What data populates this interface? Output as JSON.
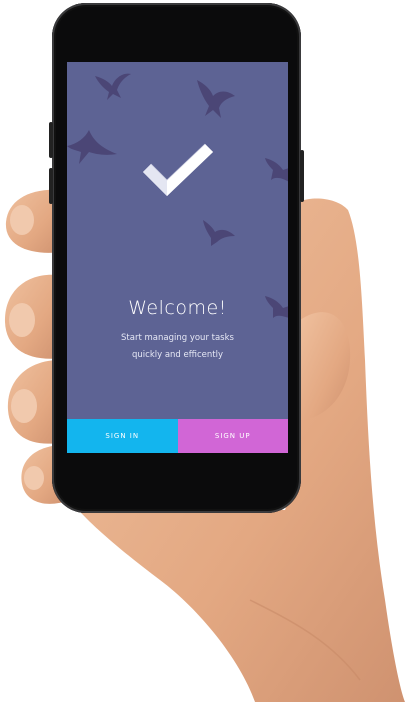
{
  "colors": {
    "screen_bg": "#5d6394",
    "sign_in_bg": "#13b5ee",
    "sign_up_bg": "#d166d6",
    "bird": "#4b4676",
    "skin": "#e7b28e"
  },
  "onboarding": {
    "icon": "checkmark-icon",
    "title": "Welcome!",
    "subtitle_line1": "Start managing your tasks",
    "subtitle_line2": "quickly and efficently"
  },
  "buttons": {
    "sign_in": "SIGN IN",
    "sign_up": "SIGN UP"
  }
}
